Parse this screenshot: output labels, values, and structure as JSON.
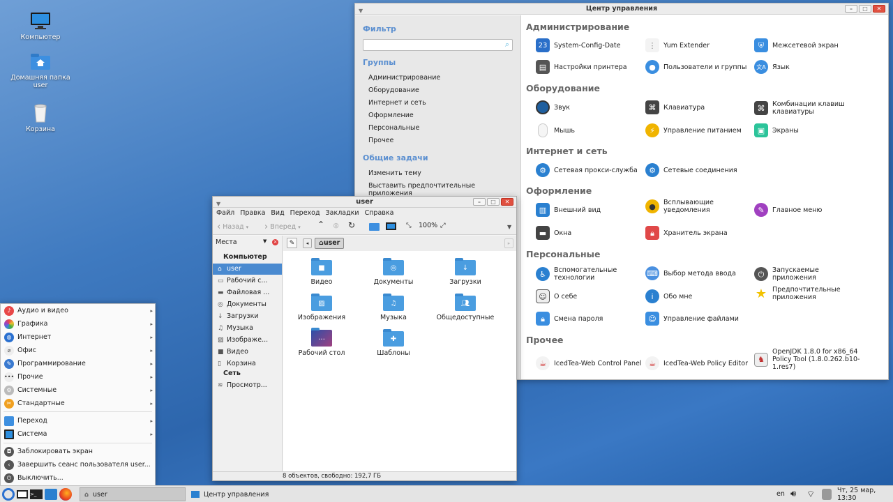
{
  "desktop": {
    "icons": [
      {
        "label": "Компьютер",
        "icon": "monitor-icon"
      },
      {
        "label": "Домашняя папка\nuser",
        "icon": "home-folder-icon"
      },
      {
        "label": "Корзина",
        "icon": "trash-icon"
      }
    ]
  },
  "control_center": {
    "title": "Центр управления",
    "filter_heading": "Фильтр",
    "filter_placeholder": "",
    "groups_heading": "Группы",
    "groups": [
      "Администрирование",
      "Оборудование",
      "Интернет и сеть",
      "Оформление",
      "Персональные",
      "Прочее"
    ],
    "tasks_heading": "Общие задачи",
    "tasks": [
      "Изменить тему",
      "Выставить предпочтительные приложения"
    ],
    "sections": [
      {
        "title": "Администрирование",
        "items": [
          "System-Config-Date",
          "Yum Extender",
          "Межсетевой экран",
          "Настройки принтера",
          "Пользователи и группы",
          "Язык"
        ]
      },
      {
        "title": "Оборудование",
        "items": [
          "Звук",
          "Клавиатура",
          "Комбинации клавиш клавиатуры",
          "Мышь",
          "Управление питанием",
          "Экраны"
        ]
      },
      {
        "title": "Интернет и сеть",
        "items": [
          "Сетевая прокси-служба",
          "Сетевые соединения"
        ]
      },
      {
        "title": "Оформление",
        "items": [
          "Внешний вид",
          "Всплывающие уведомления",
          "Главное меню",
          "Окна",
          "Хранитель экрана"
        ]
      },
      {
        "title": "Персональные",
        "items": [
          "Вспомогательные технологии",
          "Выбор метода ввода",
          "Запускаемые приложения",
          "О себе",
          "Обо мне",
          "Предпочтительные приложения",
          "Смена пароля",
          "Управление файлами"
        ]
      },
      {
        "title": "Прочее",
        "items": [
          "IcedTea-Web Control Panel",
          "IcedTea-Web Policy Editor",
          "OpenJDK 1.8.0 for x86_64 Policy Tool (1.8.0.262.b10-1.res7)"
        ]
      }
    ],
    "calendar_day": "23"
  },
  "file_manager": {
    "title": "user",
    "menu": [
      "Файл",
      "Правка",
      "Вид",
      "Переход",
      "Закладки",
      "Справка"
    ],
    "toolbar": {
      "back": "Назад",
      "forward": "Вперед",
      "zoom": "100%"
    },
    "places_label": "Места",
    "computer_heading": "Компьютер",
    "places": [
      "user",
      "Рабочий с...",
      "Файловая ...",
      "Документы",
      "Загрузки",
      "Музыка",
      "Изображе...",
      "Видео",
      "Корзина"
    ],
    "network_heading": "Сеть",
    "network": [
      "Просмотр..."
    ],
    "path": "user",
    "files": [
      "Видео",
      "Документы",
      "Загрузки",
      "Изображения",
      "Музыка",
      "Общедоступные",
      "Рабочий стол",
      "Шаблоны"
    ],
    "status": "8 объектов, свободно: 192,7 ГБ"
  },
  "start_menu": {
    "categories": [
      "Аудио и видео",
      "Графика",
      "Интернет",
      "Офис",
      "Программирование",
      "Прочие",
      "Системные",
      "Стандартные"
    ],
    "places": [
      "Переход",
      "Система"
    ],
    "actions": [
      "Заблокировать экран",
      "Завершить сеанс пользователя user...",
      "Выключить..."
    ]
  },
  "panel": {
    "tasks": [
      "user",
      "Центр управления"
    ],
    "keyboard_layout": "en",
    "clock": "Чт, 25 мар, 13:30"
  },
  "colors": {
    "accent": "#4a8ad0",
    "heading_blue": "#5b8fd0",
    "folder_blue": "#4a9de0"
  }
}
